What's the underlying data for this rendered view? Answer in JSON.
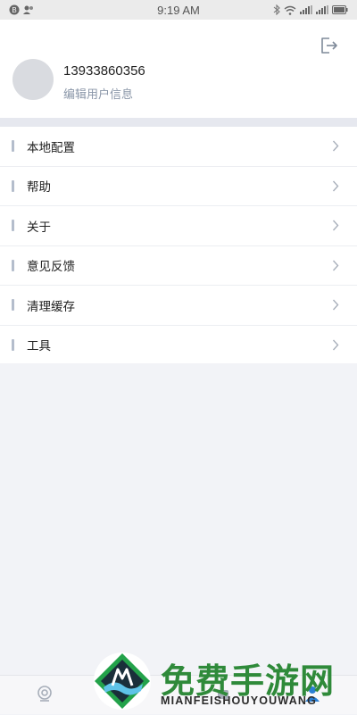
{
  "status_bar": {
    "time": "9:19 AM",
    "left_icons": [
      "notification-badge-icon",
      "contacts-icon"
    ],
    "right_icons": [
      "bluetooth-icon",
      "wifi-icon",
      "signal-icon",
      "signal-icon",
      "battery-icon"
    ]
  },
  "profile": {
    "phone": "13933860356",
    "edit_label": "编辑用户信息",
    "logout_icon": "logout-icon"
  },
  "menu": {
    "items": [
      {
        "label": "本地配置"
      },
      {
        "label": "帮助"
      },
      {
        "label": "关于"
      },
      {
        "label": "意见反馈"
      },
      {
        "label": "清理缓存"
      },
      {
        "label": "工具"
      }
    ]
  },
  "tab_bar": {
    "tabs": [
      {
        "icon": "camera-icon",
        "active": false
      },
      {
        "icon": "home-icon",
        "active": false
      },
      {
        "icon": "cloud-icon",
        "active": false
      },
      {
        "icon": "user-icon",
        "active": true
      }
    ]
  },
  "watermark": {
    "title": "免费手游网",
    "subtitle": "MIANFEISHOUYOUWANG"
  },
  "colors": {
    "accent_blue": "#2a7fd4",
    "menu_accent": "#b4bdcc",
    "watermark_green": "#2f8a3a"
  }
}
